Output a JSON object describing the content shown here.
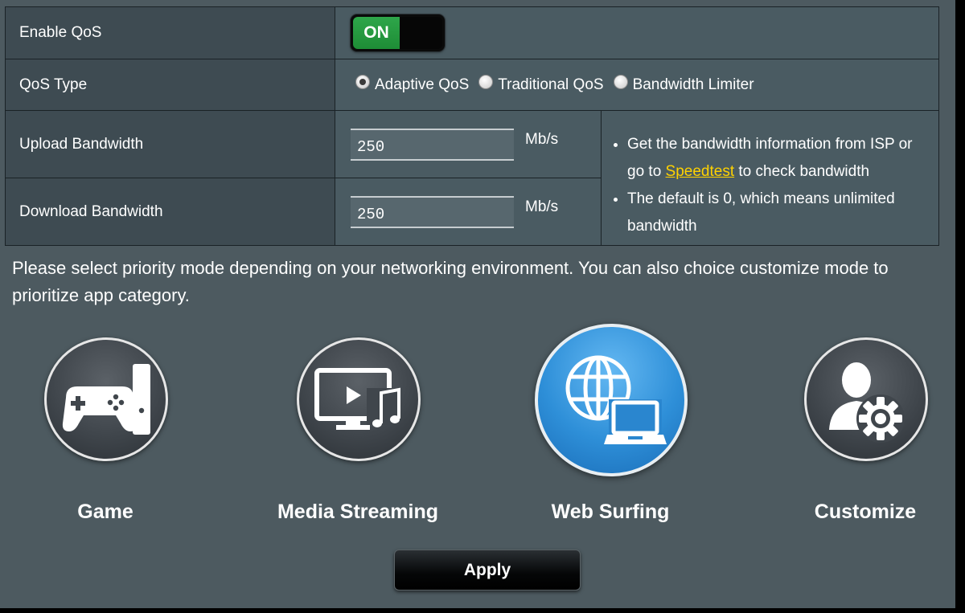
{
  "settings": {
    "enable_qos": {
      "label": "Enable QoS",
      "state": "ON"
    },
    "qos_type": {
      "label": "QoS Type",
      "options": [
        "Adaptive QoS",
        "Traditional QoS",
        "Bandwidth Limiter"
      ],
      "selected": "Adaptive QoS"
    },
    "upload": {
      "label": "Upload Bandwidth",
      "value": "250",
      "unit": "Mb/s"
    },
    "download": {
      "label": "Download Bandwidth",
      "value": "250",
      "unit": "Mb/s"
    },
    "help": {
      "item1_prefix": "Get the bandwidth information from ISP or go to ",
      "item1_link": "Speedtest",
      "item1_suffix": " to check bandwidth",
      "item2": "The default is 0, which means unlimited bandwidth"
    }
  },
  "description": "Please select priority mode depending on your networking environment. You can also choice customize mode to prioritize app category.",
  "modes": [
    {
      "label": "Game",
      "icon": "game-console-icon",
      "selected": false
    },
    {
      "label": "Media Streaming",
      "icon": "media-streaming-icon",
      "selected": false
    },
    {
      "label": "Web Surfing",
      "icon": "web-surfing-icon",
      "selected": true
    },
    {
      "label": "Customize",
      "icon": "customize-user-gear-icon",
      "selected": false
    }
  ],
  "apply_label": "Apply",
  "colors": {
    "background": "#4d5a60",
    "toggle_on": "#2ea64a",
    "link": "#ffd200",
    "selected_mode": "#2e8fd8"
  }
}
